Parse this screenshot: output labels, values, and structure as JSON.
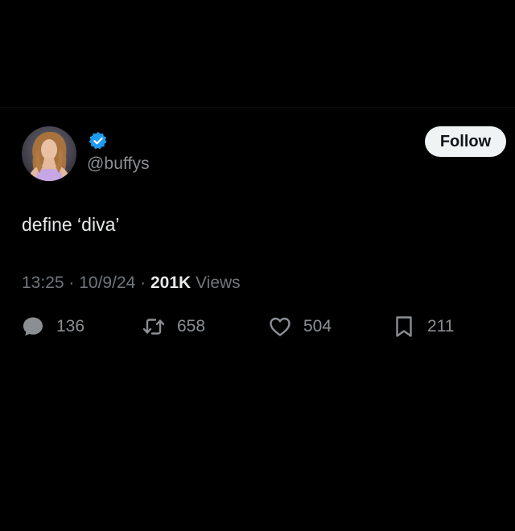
{
  "tweet": {
    "handle": "@buffys",
    "verified": true,
    "text": "define ‘diva’",
    "time": "13:25",
    "separator": " · ",
    "date": "10/9/24",
    "views_count": "201K",
    "views_label": "Views"
  },
  "follow_button": {
    "label": "Follow"
  },
  "actions": {
    "reply": {
      "icon": "speech-bubble-icon",
      "count": "136"
    },
    "retweet": {
      "icon": "retweet-icon",
      "count": "658"
    },
    "like": {
      "icon": "heart-icon",
      "count": "504"
    },
    "bookmark": {
      "icon": "bookmark-icon",
      "count": "211"
    }
  },
  "colors": {
    "background": "#000000",
    "text_primary": "#e7e9ea",
    "text_secondary": "#71767b",
    "verified_blue": "#1d9bf0",
    "follow_button_bg": "#eff3f4"
  }
}
